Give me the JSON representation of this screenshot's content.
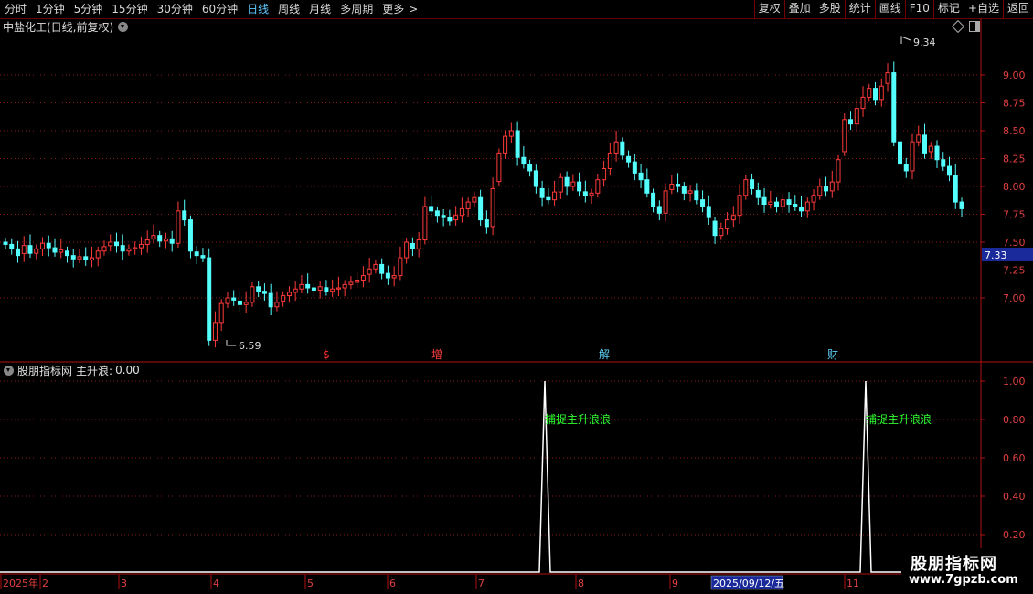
{
  "toolbar": {
    "periods": [
      {
        "label": "分时",
        "active": false
      },
      {
        "label": "1分钟",
        "active": false
      },
      {
        "label": "5分钟",
        "active": false
      },
      {
        "label": "15分钟",
        "active": false
      },
      {
        "label": "30分钟",
        "active": false
      },
      {
        "label": "60分钟",
        "active": false
      },
      {
        "label": "日线",
        "active": true
      },
      {
        "label": "周线",
        "active": false
      },
      {
        "label": "月线",
        "active": false
      },
      {
        "label": "多周期",
        "active": false
      },
      {
        "label": "更多",
        "active": false
      }
    ],
    "more_arrow": ">",
    "right_buttons": [
      "复权",
      "叠加",
      "多股",
      "统计",
      "画线",
      "F10",
      "标记",
      "+自选",
      "返回"
    ]
  },
  "main_chart": {
    "title": "中盐化工(日线,前复权)",
    "price_axis": [
      "9.00",
      "8.75",
      "8.50",
      "8.25",
      "8.00",
      "7.75",
      "7.50",
      "7.25",
      "7.00"
    ],
    "current_price": "7.33",
    "high_label": "9.34",
    "low_label": "6.59",
    "markers": [
      {
        "text": "$",
        "color": "#ff3030"
      },
      {
        "text": "增",
        "color": "#ff4040"
      },
      {
        "text": "解",
        "color": "#5fd8ff"
      },
      {
        "text": "财",
        "color": "#5fd8ff"
      }
    ]
  },
  "indicator": {
    "name": "股朋指标网",
    "series_label": "主升浪:",
    "value": "0.00",
    "axis": [
      "1.00",
      "0.80",
      "0.60",
      "0.40",
      "0.20"
    ],
    "signal_text": "捕捉主升浪浪",
    "signal_color": "#30ff30",
    "line_color": "#ffffff"
  },
  "time_axis": {
    "labels": [
      "2025年",
      "2",
      "3",
      "4",
      "5",
      "6",
      "7",
      "8",
      "9",
      "11"
    ],
    "selected_date": "2025/09/12/五"
  },
  "watermark": {
    "main": "股朋指标网",
    "sub": "www.7gpzb.com"
  },
  "colors": {
    "up": "#ff3a3a",
    "down": "#54ffff",
    "grid": "#8a1a1a",
    "axis": "#b01010",
    "highlight_bg": "#1a2a9a"
  }
}
